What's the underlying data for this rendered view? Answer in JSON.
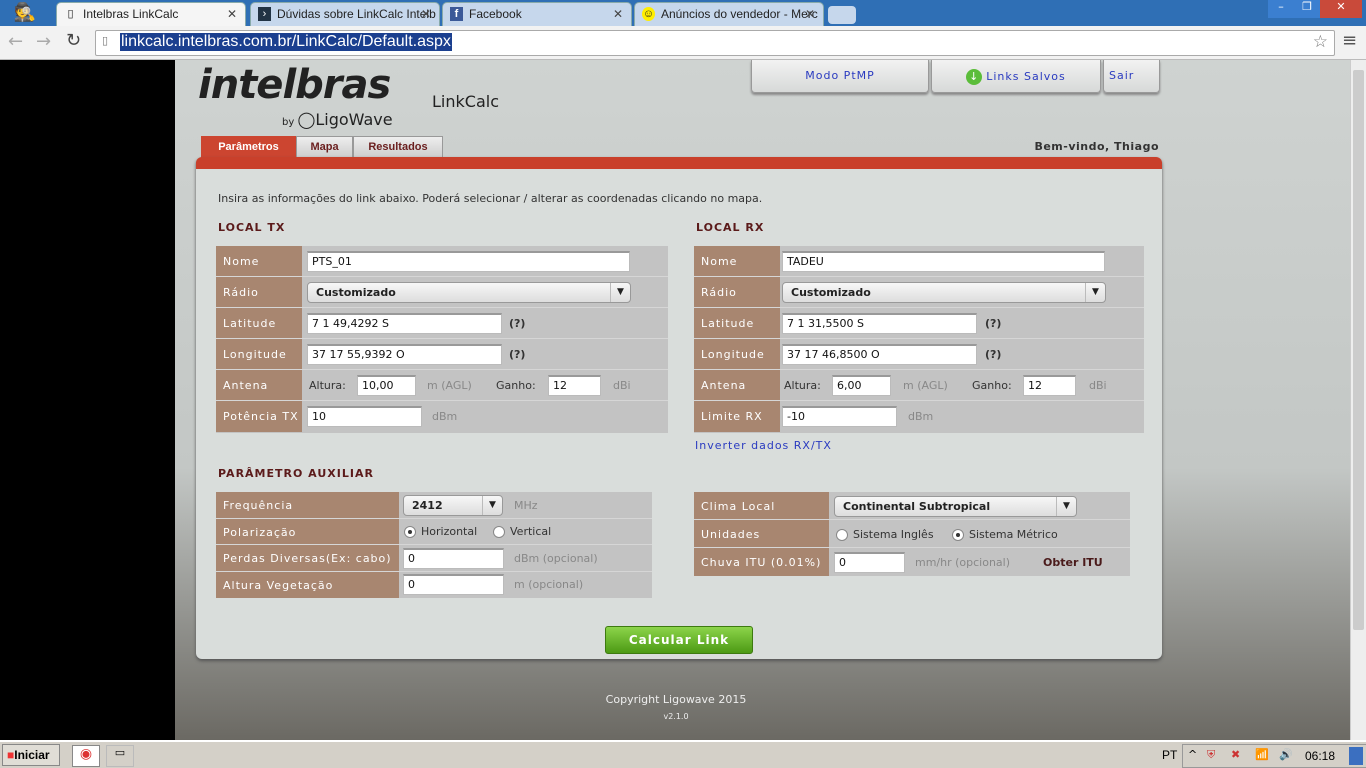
{
  "browser": {
    "tabs": [
      {
        "title": "Intelbras LinkCalc",
        "icon": "page-icon"
      },
      {
        "title": "Dúvidas sobre LinkCalc Intelb",
        "icon": "forum-icon"
      },
      {
        "title": "Facebook",
        "icon": "facebook-icon"
      },
      {
        "title": "Anúncios do vendedor - Merc",
        "icon": "mercadolivre-icon"
      }
    ],
    "url": "linkcalc.intelbras.com.br/LinkCalc/Default.aspx"
  },
  "header": {
    "logo": "intelbras",
    "logo_sub": "by LigoWave",
    "app_title": "LinkCalc",
    "buttons": {
      "ptmp": "Modo PtMP",
      "saved": "Links Salvos",
      "exit": "Sair"
    },
    "welcome": "Bem-vindo, Thiago",
    "tabs": [
      "Parâmetros",
      "Mapa",
      "Resultados"
    ]
  },
  "intro": "Insira as informações do link abaixo. Poderá selecionar / alterar as coordenadas clicando no mapa.",
  "tx": {
    "title": "LOCAL TX",
    "labels": [
      "Nome",
      "Rádio",
      "Latitude",
      "Longitude",
      "Antena",
      "Potência TX"
    ],
    "name": "PTS_01",
    "radio": "Customizado",
    "lat": "7 1 49,4292 S",
    "lon": "37 17 55,9392 O",
    "help": "(?)",
    "altura_label": "Altura:",
    "altura": "10,00",
    "altura_unit": "m  (AGL)",
    "ganho_label": "Ganho:",
    "ganho": "12",
    "ganho_unit": "dBi",
    "power": "10",
    "power_unit": "dBm"
  },
  "rx": {
    "title": "LOCAL RX",
    "labels": [
      "Nome",
      "Rádio",
      "Latitude",
      "Longitude",
      "Antena",
      "Limite RX"
    ],
    "name": "TADEU",
    "radio": "Customizado",
    "lat": "7 1 31,5500 S",
    "lon": "37 17 46,8500 O",
    "help": "(?)",
    "altura_label": "Altura:",
    "altura": "6,00",
    "altura_unit": "m  (AGL)",
    "ganho_label": "Ganho:",
    "ganho": "12",
    "ganho_unit": "dBi",
    "limit": "-10",
    "limit_unit": "dBm",
    "invert": "Inverter dados RX/TX"
  },
  "aux": {
    "title": "PARÂMETRO AUXILIAR",
    "labels": [
      "Frequência",
      "Polarização",
      "Perdas Diversas(Ex: cabo)",
      "Altura Vegetação"
    ],
    "freq": "2412",
    "freq_unit": "MHz",
    "pol_h": "Horizontal",
    "pol_v": "Vertical",
    "pol_selected": "Horizontal",
    "loss": "0",
    "loss_unit": "dBm   (opcional)",
    "veg": "0",
    "veg_unit": "m    (opcional)"
  },
  "env": {
    "labels": [
      "Clima Local",
      "Unidades",
      "Chuva ITU (0.01%)"
    ],
    "climate": "Continental Subtropical",
    "unit_en": "Sistema Inglês",
    "unit_metric": "Sistema Métrico",
    "unit_selected": "Sistema Métrico",
    "rain": "0",
    "rain_unit": "mm/hr   (opcional)",
    "get_itu": "Obter ITU"
  },
  "calc": "Calcular Link",
  "footer": {
    "copyright": "Copyright Ligowave 2015",
    "version": "v2.1.0"
  },
  "taskbar": {
    "start": "Iniciar",
    "lang": "PT",
    "time": "06:18"
  },
  "colors": {
    "accent": "#c9402b",
    "label_bg": "#a88670",
    "calc_button": "#5aa51e"
  }
}
